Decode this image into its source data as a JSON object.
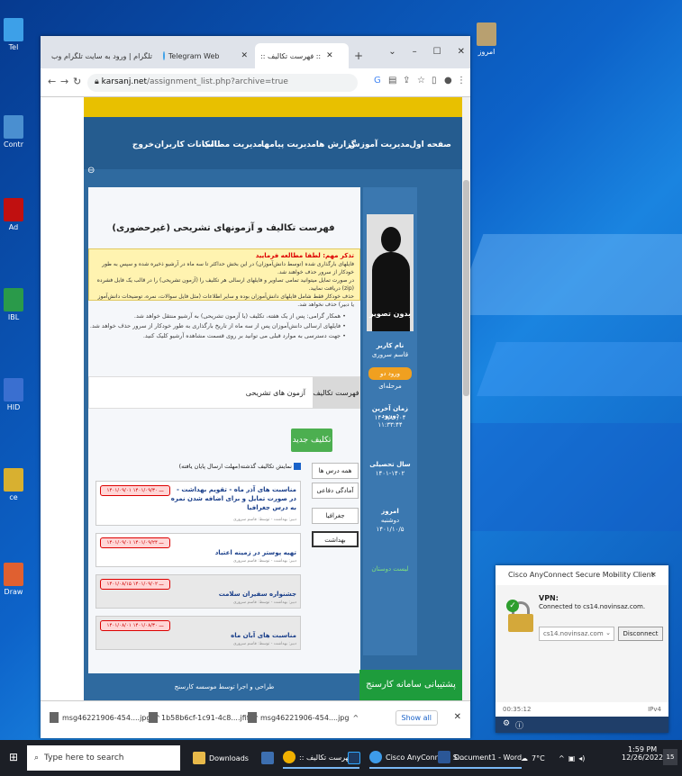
{
  "desktop": {
    "icons": [
      {
        "label": "Tel",
        "color": "#3da0e8"
      },
      {
        "label": "Contr",
        "color": "#4a8fd0"
      },
      {
        "label": "Ad",
        "color": "#c01010"
      },
      {
        "label": "IBL",
        "color": "#2a9a4a"
      },
      {
        "label": "HID",
        "color": "#3a6fd0"
      },
      {
        "label": "ce",
        "color": "#d8b030"
      },
      {
        "label": "Draw",
        "color": "#e06030"
      }
    ],
    "right_icon_label": "امروز"
  },
  "browser": {
    "tabs": [
      {
        "label": "تلگرام | ورود به سایت تلگرام وب",
        "color": "#444"
      },
      {
        "label": "Telegram Web",
        "color": "#3da0e8"
      },
      {
        "label": ":: فهرست تکالیف ::",
        "color": "#222"
      }
    ],
    "url_host": "karsanj.net",
    "url_path": "/assignment_list.php?archive=true"
  },
  "site": {
    "nav": [
      "صفحه اول",
      "مدیریت آموزش",
      "گزارش ها",
      "مدیریت پیامها",
      "مدیریت مطالب",
      "امکانات کاربران",
      "خروج"
    ],
    "page_title": "فهرست تکالیف و آزمونهای تشریحی (غیرحضوری)",
    "warning_head": "تذکر مهم: لطفا مطالعه فرمایید",
    "warning_lines": [
      "فایلهای بارگذاری شده (توسط دانش‌آموزان) در این بخش حداکثر تا سه ماه در آرشیو ذخیره شده و سپس به طور خودکار از سرور حذف خواهند شد.",
      "در صورت تمایل میتوانید تمامی تصاویر و فایلهای ارسالی هر تکلیف را (آزمون تشریحی) را در قالب یک فایل فشرده (zip) دریافت نمایید.",
      "حذف خودکار فقط شامل فایلهای دانش‌آموزان بوده و سایر اطلاعات (مثل فایل سوالات، نمره، توضیحات دانش‌آموز یا دبیر) حذف نخواهد شد."
    ],
    "bullets": [
      "همکار گرامی: پس از یک هفته، تکلیف (یا آزمون تشریحی) به آرشیو منتقل خواهد شد.",
      "فایلهای ارسالی دانش‌آموزان پس از سه ماه از تاریخ بارگذاری به طور خودکار از سرور حذف خواهد شد.",
      "جهت دسترسی به موارد قبلی می توانید بر روی قسمت مشاهده آرشیو کلیک کنید."
    ],
    "tab_assignments": "فهرست تکالیف",
    "tab_exams": "آزمون های تشریحی",
    "new_button": "تکلیف جدید",
    "show_past_label": "نمایش تکالیف گذشته(مهلت ارسال پایان یافته)",
    "filters": [
      "همه درس ها",
      "آمادگی دفاعی",
      "جغرافیا",
      "بهداشت"
    ],
    "cards": [
      {
        "title": "مناسبت های آذر ماه - تقویم بهداشت - در صورت تمایل و برای اضافه شدن نمره به درس جغرافیا",
        "dates": "۱۴۰۱/۰۹/۰۱ ـــ ۱۴۰۱/۰۹/۳۰",
        "sub": "دبیر: بهداشت - توسط: قاسم سروری",
        "gray": false
      },
      {
        "title": "تهیه پوستر در زمینه اعتیاد",
        "dates": "۱۴۰۱/۰۹/۰۱ ـــ ۱۴۰۱/۰۹/۲۴",
        "sub": "دبیر: بهداشت - توسط: قاسم سروری",
        "gray": false
      },
      {
        "title": "جشنواره سفیران سلامت",
        "dates": "۱۴۰۱/۰۸/۱۵ ـــ ۱۴۰۱/۰۹/۰۲",
        "sub": "دبیر: بهداشت - توسط: قاسم سروری",
        "gray": true
      },
      {
        "title": "مناسبت های آبان ماه",
        "dates": "۱۴۰۱/۰۸/۰۱ ـــ ۱۴۰۱/۰۸/۳۰",
        "sub": "دبیر: بهداشت - توسط: قاسم سروری",
        "gray": true
      }
    ],
    "footer": "طراحی و اجرا توسط موسسه کارسنج",
    "support": "پشتیبانی سامانه کارسنج"
  },
  "sidebar": {
    "no_photo": "بدون تصویر",
    "username_label": "نام کاربر",
    "username": "قاسم سروری",
    "login_button": "ورود دو مرحله‌ای",
    "last_login_label": "زمان آخرین ورود:",
    "last_login": "۱۴۰۱/۱۰/۰۴ ۱۱:۳۳:۴۴",
    "year_label": "سال تحصیلی",
    "year": "۱۴۰۱-۱۴۰۲",
    "today_label": "امروز",
    "today_day": "دوشنبه",
    "today_date": "۱۴۰۱/۱۰/۵",
    "friends_label": "لیست دوستان"
  },
  "downloads": {
    "items": [
      "msg46221906-454....jpg",
      "1b58b6cf-1c91-4c8....jfif",
      "msg46221906-454....jpg"
    ],
    "show_all": "Show all"
  },
  "cisco": {
    "title": "Cisco AnyConnect Secure Mobility Client",
    "vpn_label": "VPN:",
    "vpn_status": "Connected to cs14.novinsaz.com.",
    "server": "cs14.novinsaz.com",
    "disconnect": "Disconnect",
    "timer": "00:35:12",
    "ip": "IPv4"
  },
  "taskbar": {
    "search_placeholder": "Type here to search",
    "items": [
      {
        "label": "Downloads",
        "color": "#e8b94a"
      },
      {
        "label": ":: فهرست تکالیف ::",
        "color": "#f0b000"
      },
      {
        "label": "Cisco AnyConnect S...",
        "color": "#3d9be9"
      },
      {
        "label": "Document1 - Word",
        "color": "#2b5797"
      }
    ],
    "weather": "7°C",
    "time": "1:59 PM",
    "date": "12/26/2022",
    "notif_count": "15"
  }
}
